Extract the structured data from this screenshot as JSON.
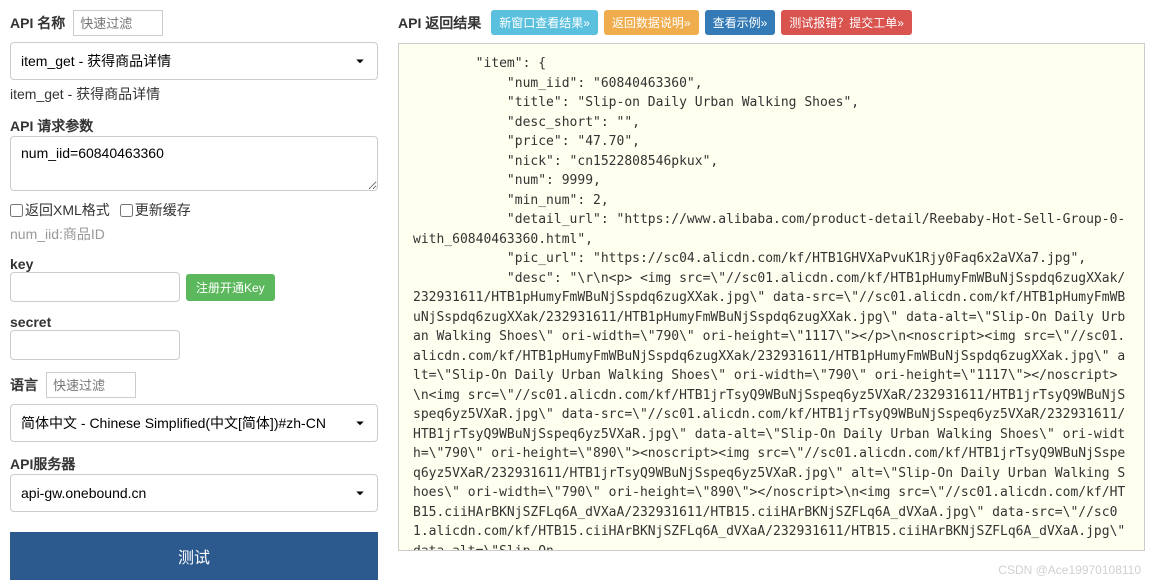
{
  "left": {
    "api_name_label": "API 名称",
    "filter_placeholder": "快速过滤",
    "api_select_value": "item_get - 获得商品详情",
    "api_helper": "item_get - 获得商品详情",
    "api_params_label": "API 请求参数",
    "api_params_value": "num_iid=60840463360",
    "checkbox_xml": "返回XML格式",
    "checkbox_cache": "更新缓存",
    "params_hint": "num_iid:商品ID",
    "key_label": "key",
    "secret_label": "secret",
    "register_btn": "注册开通Key",
    "lang_label": "语言",
    "lang_select_value": "简体中文 - Chinese Simplified(中文[简体])#zh-CN",
    "server_label": "API服务器",
    "server_value": "api-gw.onebound.cn",
    "test_btn": "测试"
  },
  "right": {
    "title": "API 返回结果",
    "btn_newwin": "新窗口查看结果»",
    "btn_explain": "返回数据说明»",
    "btn_example": "查看示例»",
    "btn_report": "测试报错？提交工单»",
    "json_text": "        \"item\": {\n            \"num_iid\": \"60840463360\",\n            \"title\": \"Slip-on Daily Urban Walking Shoes\",\n            \"desc_short\": \"\",\n            \"price\": \"47.70\",\n            \"nick\": \"cn1522808546pkux\",\n            \"num\": 9999,\n            \"min_num\": 2,\n            \"detail_url\": \"https://www.alibaba.com/product-detail/Reebaby-Hot-Sell-Group-0-with_60840463360.html\",\n            \"pic_url\": \"https://sc04.alicdn.com/kf/HTB1GHVXaPvuK1Rjy0Faq6x2aVXa7.jpg\",\n            \"desc\": \"\\r\\n<p> <img src=\\\"//sc01.alicdn.com/kf/HTB1pHumyFmWBuNjSspdq6zugXXak/232931611/HTB1pHumyFmWBuNjSspdq6zugXXak.jpg\\\" data-src=\\\"//sc01.alicdn.com/kf/HTB1pHumyFmWBuNjSspdq6zugXXak/232931611/HTB1pHumyFmWBuNjSspdq6zugXXak.jpg\\\" data-alt=\\\"Slip-On Daily Urban Walking Shoes\\\" ori-width=\\\"790\\\" ori-height=\\\"1117\\\"></p>\\n<noscript><img src=\\\"//sc01.alicdn.com/kf/HTB1pHumyFmWBuNjSspdq6zugXXak/232931611/HTB1pHumyFmWBuNjSspdq6zugXXak.jpg\\\" alt=\\\"Slip-On Daily Urban Walking Shoes\\\" ori-width=\\\"790\\\" ori-height=\\\"1117\\\"></noscript>\\n<img src=\\\"//sc01.alicdn.com/kf/HTB1jrTsyQ9WBuNjSspeq6yz5VXaR/232931611/HTB1jrTsyQ9WBuNjSspeq6yz5VXaR.jpg\\\" data-src=\\\"//sc01.alicdn.com/kf/HTB1jrTsyQ9WBuNjSspeq6yz5VXaR/232931611/HTB1jrTsyQ9WBuNjSspeq6yz5VXaR.jpg\\\" data-alt=\\\"Slip-On Daily Urban Walking Shoes\\\" ori-width=\\\"790\\\" ori-height=\\\"890\\\"><noscript><img src=\\\"//sc01.alicdn.com/kf/HTB1jrTsyQ9WBuNjSspeq6yz5VXaR/232931611/HTB1jrTsyQ9WBuNjSspeq6yz5VXaR.jpg\\\" alt=\\\"Slip-On Daily Urban Walking Shoes\\\" ori-width=\\\"790\\\" ori-height=\\\"890\\\"></noscript>\\n<img src=\\\"//sc01.alicdn.com/kf/HTB15.ciiHArBKNjSZFLq6A_dVXaA/232931611/HTB15.ciiHArBKNjSZFLq6A_dVXaA.jpg\\\" data-src=\\\"//sc01.alicdn.com/kf/HTB15.ciiHArBKNjSZFLq6A_dVXaA/232931611/HTB15.ciiHArBKNjSZFLq6A_dVXaA.jpg\\\" data-alt=\\\"Slip-On"
  },
  "watermark": "CSDN @Ace19970108110"
}
